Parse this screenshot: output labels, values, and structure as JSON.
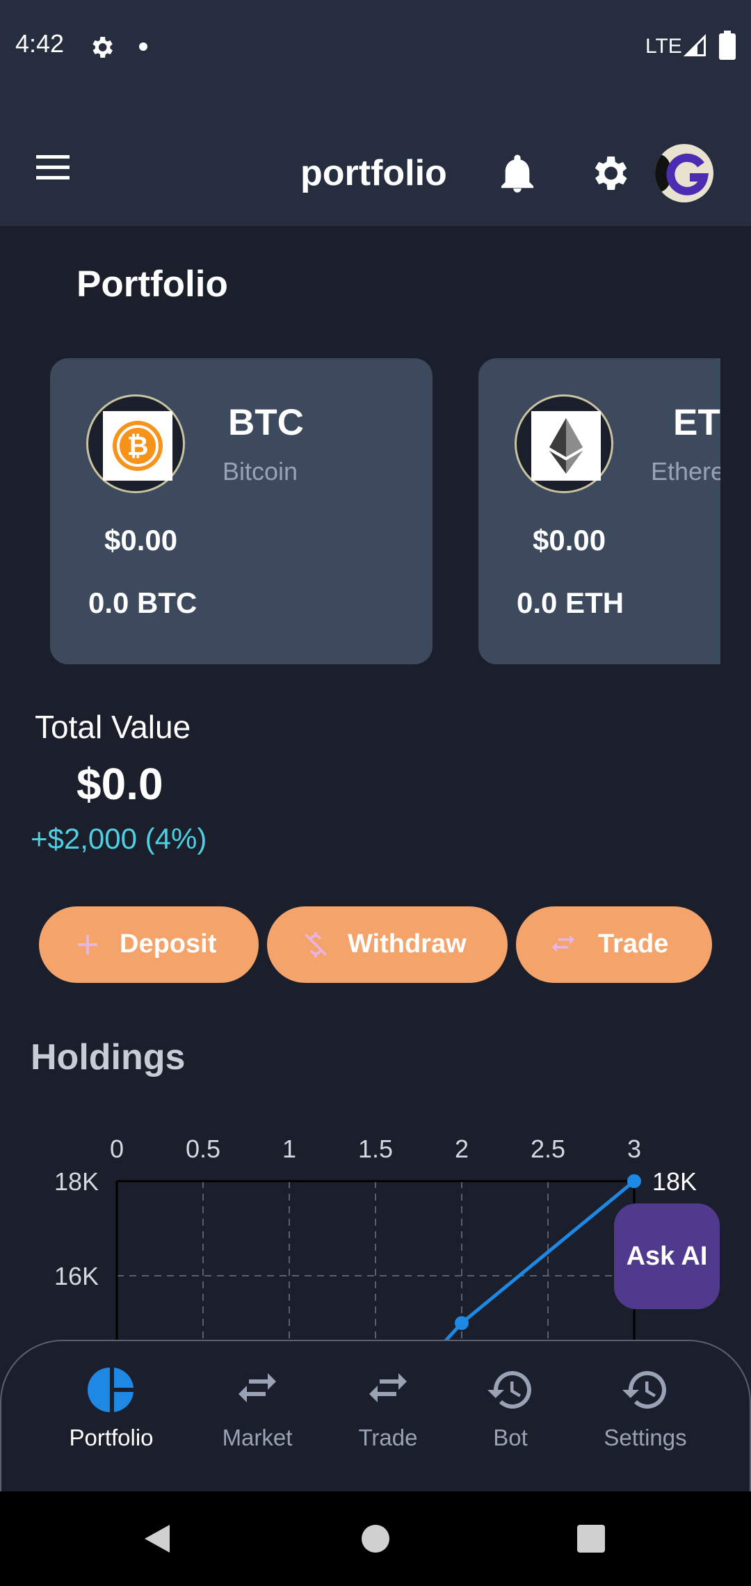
{
  "status_bar": {
    "time": "4:42",
    "network": "LTE"
  },
  "app_bar": {
    "title": "portfolio"
  },
  "page": {
    "heading": "Portfolio"
  },
  "coins": [
    {
      "symbol": "BTC",
      "name": "Bitcoin",
      "usd": "$0.00",
      "amount": "0.0 BTC"
    },
    {
      "symbol": "ET",
      "name": "Ethere",
      "usd": "$0.00",
      "amount": "0.0 ETH"
    }
  ],
  "total": {
    "label": "Total Value",
    "value": "$0.0",
    "change": "+$2,000 (4%)"
  },
  "actions": {
    "deposit": "Deposit",
    "withdraw": "Withdraw",
    "trade": "Trade"
  },
  "holdings": {
    "title": "Holdings"
  },
  "chart_data": {
    "type": "line",
    "x_ticks": [
      "0",
      "0.5",
      "1",
      "1.5",
      "2",
      "2.5",
      "3"
    ],
    "y_ticks": [
      "18K",
      "16K"
    ],
    "series": [
      {
        "x": [
          1.5,
          2,
          3
        ],
        "y": [
          13000,
          15000,
          18000
        ]
      }
    ],
    "point_label": "18K",
    "xlim": [
      0,
      3
    ],
    "grid": true,
    "color": "#1e88e5"
  },
  "fab": {
    "label": "Ask AI"
  },
  "nav": [
    {
      "label": "Portfolio",
      "icon": "pie-chart-icon",
      "active": true
    },
    {
      "label": "Market",
      "icon": "swap-icon",
      "active": false
    },
    {
      "label": "Trade",
      "icon": "swap-icon",
      "active": false
    },
    {
      "label": "Bot",
      "icon": "history-icon",
      "active": false
    },
    {
      "label": "Settings",
      "icon": "history-icon",
      "active": false
    }
  ],
  "colors": {
    "accent": "#f4a36b",
    "primary": "#1e88e5",
    "fab": "#4f3a8e",
    "positive": "#4dd0e1"
  }
}
